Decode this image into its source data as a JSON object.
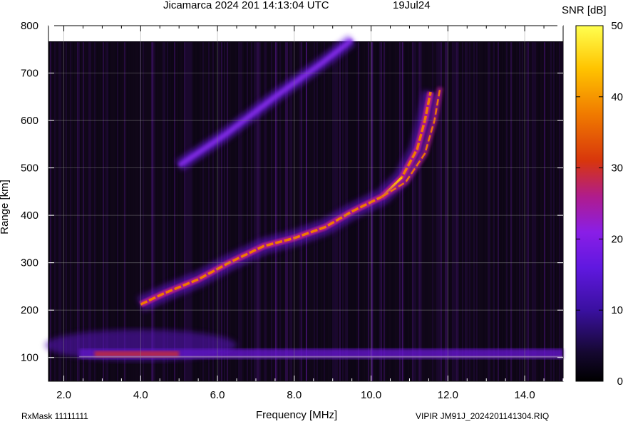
{
  "header": {
    "title": "Jicamarca 2024 201 14:13:04 UTC",
    "date": "19Jul24"
  },
  "footer": {
    "left": "RxMask 11111111",
    "right": "VIPIR  JM91J_2024201141304.RIQ"
  },
  "chart_data": {
    "type": "heatmap",
    "title": "Jicamarca 2024 201 14:13:04 UTC",
    "xlabel": "Frequency [MHz]",
    "ylabel": "Range [km]",
    "xlim": [
      1.6,
      15.0
    ],
    "ylim": [
      50,
      800
    ],
    "x_ticks": [
      2.0,
      4.0,
      6.0,
      8.0,
      10.0,
      12.0,
      14.0
    ],
    "x_tick_labels": [
      "2.0",
      "4.0",
      "6.0",
      "8.0",
      "10.0",
      "12.0",
      "14.0"
    ],
    "y_ticks": [
      100,
      200,
      300,
      400,
      500,
      600,
      700,
      800
    ],
    "y_tick_labels": [
      "100",
      "200",
      "300",
      "400",
      "500",
      "600",
      "700",
      "800"
    ],
    "grid": true,
    "colorbar": {
      "label": "SNR [dB]",
      "min": 0,
      "max": 50,
      "ticks": [
        0,
        10,
        20,
        30,
        40,
        50
      ],
      "tick_labels": [
        "0",
        "10",
        "20",
        "30",
        "40",
        "50"
      ],
      "colors": [
        "#000000",
        "#1a0a3a",
        "#5a14d8",
        "#8a1ee6",
        "#b01c8c",
        "#d8360c",
        "#f07a00",
        "#ffc400",
        "#ffff50"
      ]
    },
    "features": [
      {
        "name": "E/Es-layer echo",
        "freq_range_mhz": [
          2.4,
          15.0
        ],
        "range_km": 105,
        "peak_snr_db": 28
      },
      {
        "name": "F-layer O-mode trace",
        "points": [
          [
            4.0,
            212
          ],
          [
            4.6,
            235
          ],
          [
            5.5,
            265
          ],
          [
            6.3,
            300
          ],
          [
            7.2,
            335
          ],
          [
            8.0,
            352
          ],
          [
            8.8,
            375
          ],
          [
            9.5,
            408
          ],
          [
            10.3,
            440
          ],
          [
            10.8,
            480
          ],
          [
            11.2,
            540
          ],
          [
            11.4,
            600
          ],
          [
            11.55,
            660
          ]
        ]
      },
      {
        "name": "F-layer X-mode trace",
        "points": [
          [
            10.3,
            440
          ],
          [
            10.9,
            470
          ],
          [
            11.4,
            530
          ],
          [
            11.65,
            600
          ],
          [
            11.8,
            670
          ]
        ]
      },
      {
        "name": "Second-hop echo",
        "points": [
          [
            5.0,
            505
          ],
          [
            6.2,
            570
          ],
          [
            7.5,
            650
          ],
          [
            8.7,
            720
          ],
          [
            9.5,
            770
          ]
        ]
      }
    ]
  }
}
